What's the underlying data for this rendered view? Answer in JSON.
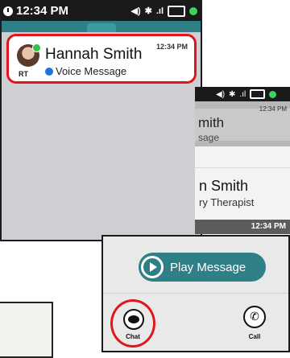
{
  "screen1": {
    "status_time": "12:34 PM",
    "notification": {
      "name": "Hannah Smith",
      "type": "Voice Message",
      "time": "12:34 PM",
      "initials": "RT"
    }
  },
  "screen2": {
    "card_name_partial": "mith",
    "card_type_partial": "sage",
    "card_time": "12:34 PM",
    "name_partial": "n Smith",
    "role_partial": "ry Therapist",
    "footer_time": "12:34 PM"
  },
  "screen3": {
    "play_label": "Play Message",
    "chat_label": "Chat",
    "call_label": "Call"
  },
  "colors": {
    "teal": "#2f7f86",
    "highlight_red": "#e0161c",
    "status_green": "#3ed35c",
    "voice_blue": "#1e73d9"
  }
}
